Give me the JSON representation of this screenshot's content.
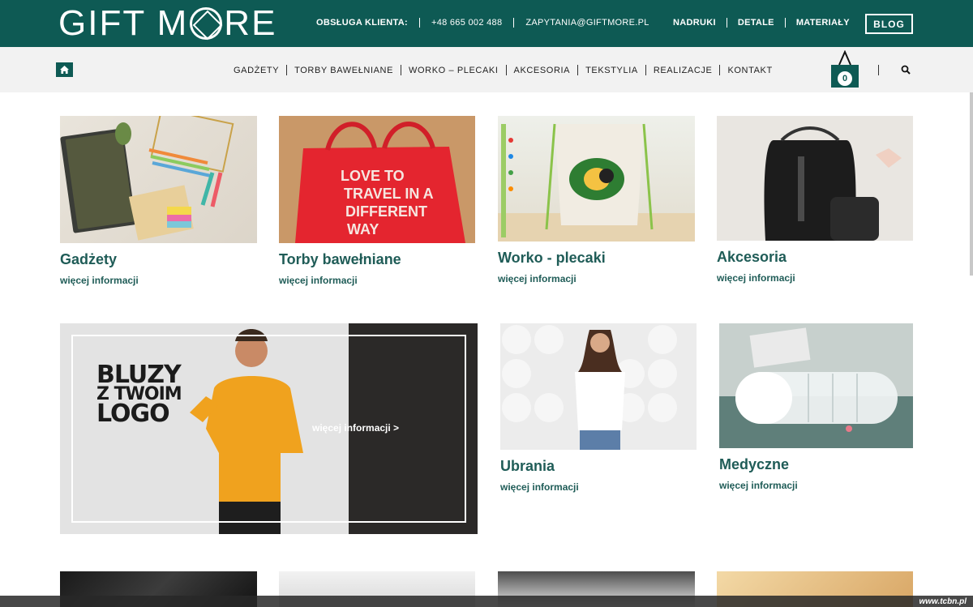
{
  "header": {
    "logo": {
      "left": "GIFT M",
      "right": "RE"
    },
    "contact_label": "OBSŁUGA KLIENTA:",
    "phone": "+48 665 002 488",
    "email": "ZAPYTANIA@GIFTMORE.PL",
    "top_links": [
      "NADRUKI",
      "DETALE",
      "MATERIAŁY"
    ],
    "blog": "BLOG"
  },
  "nav": {
    "items": [
      "GADŻETY",
      "TORBY BAWEŁNIANE",
      "WORKO – PLECAKI",
      "AKCESORIA",
      "TEKSTYLIA",
      "REALIZACJE",
      "KONTAKT"
    ],
    "cart_count": "0"
  },
  "tiles": [
    {
      "title": "Gadżety",
      "more": "więcej informacji"
    },
    {
      "title": "Torby bawełniane",
      "more": "więcej informacji",
      "image_text": [
        "LOVE TO",
        "TRAVEL IN A",
        "DIFFERENT",
        "WAY"
      ]
    },
    {
      "title": "Worko - plecaki",
      "more": "więcej informacji"
    },
    {
      "title": "Akcesoria",
      "more": "więcej informacji"
    },
    {
      "title": "Ubrania",
      "more": "więcej informacji"
    },
    {
      "title": "Medyczne",
      "more": "więcej informacji"
    }
  ],
  "banner": {
    "line1": "BLUZY",
    "line2": "Z TWOIM",
    "line3": "LOGO",
    "link": "więcej informacji >"
  },
  "watermark": "www.tcbn.pl",
  "colors": {
    "brand": "#0e5a54",
    "text": "#1f5c57"
  }
}
